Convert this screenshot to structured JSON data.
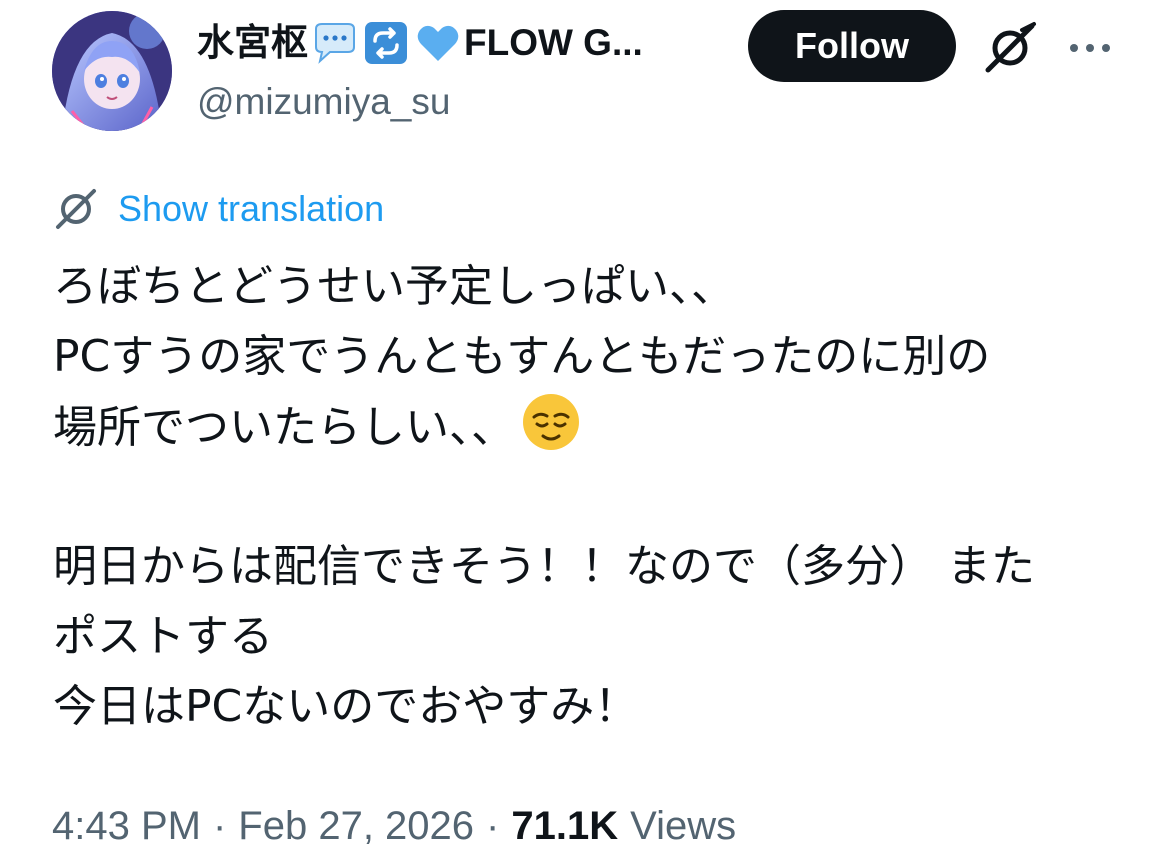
{
  "author": {
    "name_prefix": "水宮枢",
    "name_suffix": "FLOW G...",
    "handle": "@mizumiya_su",
    "avatar_icon": "anime-avatar"
  },
  "header": {
    "follow_label": "Follow",
    "grok_icon": "grok-icon",
    "more_icon": "more-options-icon"
  },
  "translation": {
    "label": "Show translation",
    "icon": "grok-translate-icon"
  },
  "tweet": {
    "lines": [
      "ろぼちとどうせい予定しっぱい、、",
      "PCすうの家でうんともすんともだったのに別の",
      "場所でついたらしい、、",
      "",
      "明日からは配信できそう！！なので（多分） また",
      "ポストする",
      "今日はPCないのでおやすみ！"
    ],
    "emoji": "relieved-face-emoji"
  },
  "meta": {
    "time": "4:43 PM",
    "separator": "·",
    "date": "Feb 27, 2026",
    "views_count": "71.1K",
    "views_label": "Views"
  },
  "colors": {
    "text": "#0f1419",
    "secondary": "#536471",
    "link": "#1d9bf0",
    "button_bg": "#0f1419"
  }
}
